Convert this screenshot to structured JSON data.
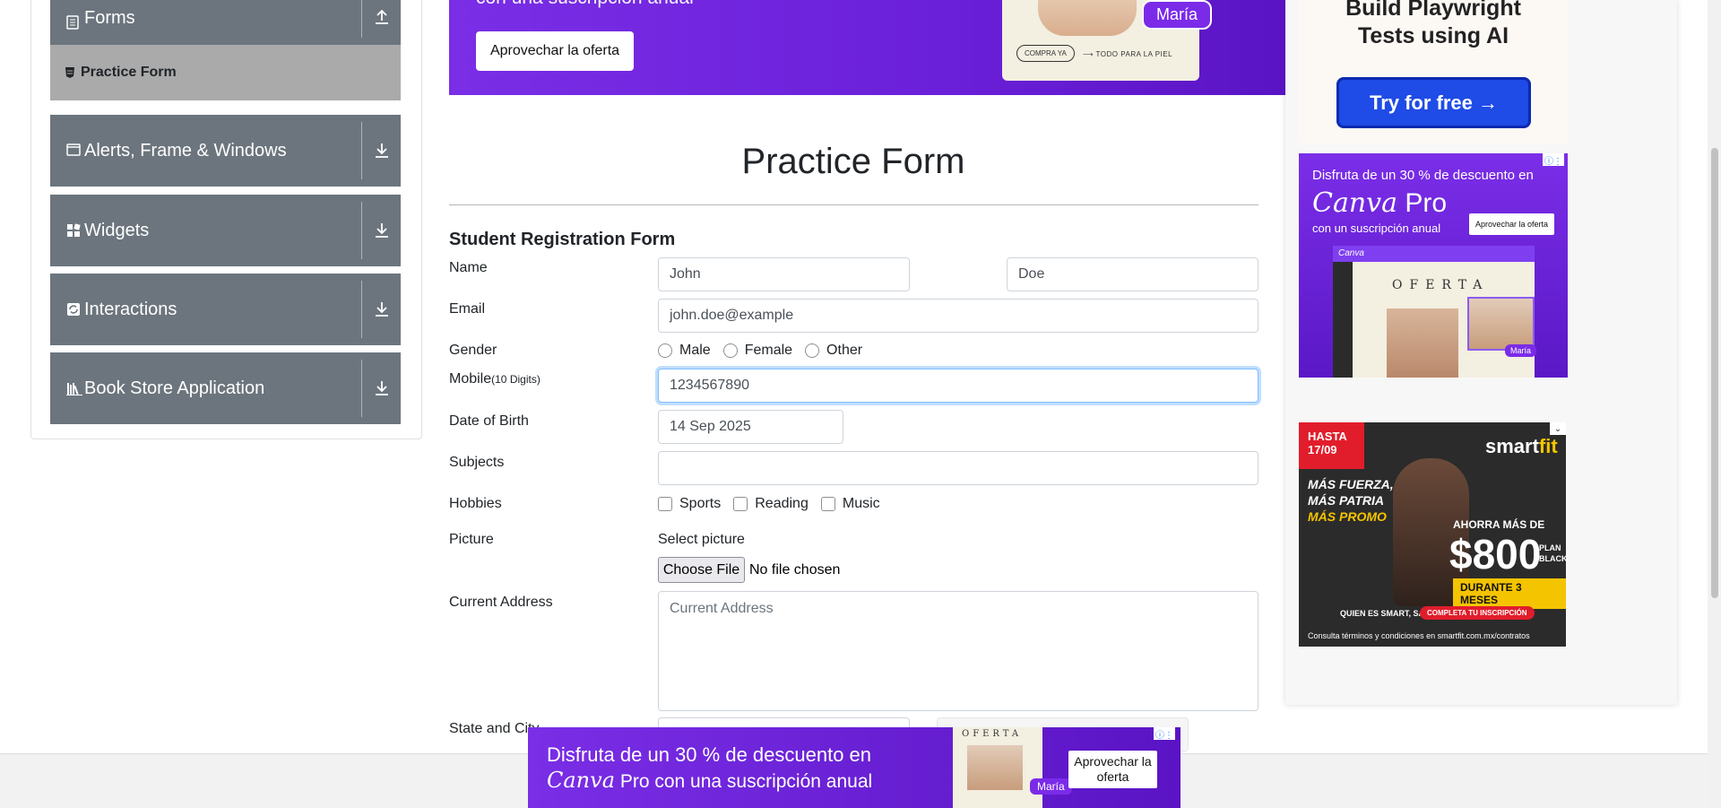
{
  "sidebar": {
    "forms_label": "Forms",
    "practice_form_label": "Practice Form",
    "groups": [
      {
        "label": "Alerts, Frame & Windows"
      },
      {
        "label": "Widgets"
      },
      {
        "label": "Interactions"
      },
      {
        "label": "Book Store Application"
      }
    ]
  },
  "top_ad": {
    "headline_fragment": "con una suscripción anual",
    "cta": "Aprovechar la oferta",
    "tag": "María",
    "compra": "COMPRA YA",
    "arrow_text": "TODO PARA LA PIEL"
  },
  "form": {
    "page_title": "Practice Form",
    "heading": "Student Registration Form",
    "name_label": "Name",
    "first_name": "John",
    "last_name": "Doe",
    "email_label": "Email",
    "email_value": "john.doe@example",
    "gender_label": "Gender",
    "gender_options": [
      "Male",
      "Female",
      "Other"
    ],
    "mobile_label": "Mobile",
    "mobile_hint": "(10 Digits)",
    "mobile_value": "1234567890",
    "dob_label": "Date of Birth",
    "dob_value": "14 Sep 2025",
    "subjects_label": "Subjects",
    "subjects_value": "",
    "hobbies_label": "Hobbies",
    "hobby_options": [
      "Sports",
      "Reading",
      "Music"
    ],
    "picture_label": "Picture",
    "select_picture": "Select picture",
    "choose_file": "Choose File",
    "no_file": "No file chosen",
    "address_label": "Current Address",
    "address_placeholder": "Current Address",
    "state_city_label": "State and City"
  },
  "right_ads": {
    "playwright": {
      "title_line1": "Build Playwright",
      "title_line2": "Tests using AI",
      "button": "Try for free →"
    },
    "canva": {
      "line1": "Disfruta de un 30 % de descuento en",
      "brand_italic": "Canva",
      "brand_rest": " Pro",
      "line3": "con un suscripción anual",
      "cta": "Aprovechar la oferta",
      "mock_bar": "Canva",
      "oferta": "OFERTA",
      "tag": "María"
    },
    "smartfit": {
      "date_top": "HASTA",
      "date_bottom": "17/09",
      "brand": "smart",
      "brand_accent": "fit",
      "line1": "MÁS FUERZA,",
      "line2": "MÁS PATRIA",
      "line3": "MÁS PROMO",
      "ahorra": "AHORRA MÁS DE",
      "amount": "$800",
      "plan": "PLAN BLACK",
      "durante": "DURANTE 3 MESES",
      "quien": "QUIEN ES SMART, SABE.",
      "completa": "COMPLETA TU INSCRIPCIÓN",
      "consulta": "Consulta términos y condiciones en smartfit.com.mx/contratos"
    }
  },
  "bottom_ad": {
    "line1": "Disfruta de un 30 % de descuento en",
    "brand_italic": "Canva",
    "line2_rest": " Pro con una suscripción anual",
    "oferta": "OFERTA",
    "tag": "María",
    "cta": "Aprovechar la oferta"
  }
}
